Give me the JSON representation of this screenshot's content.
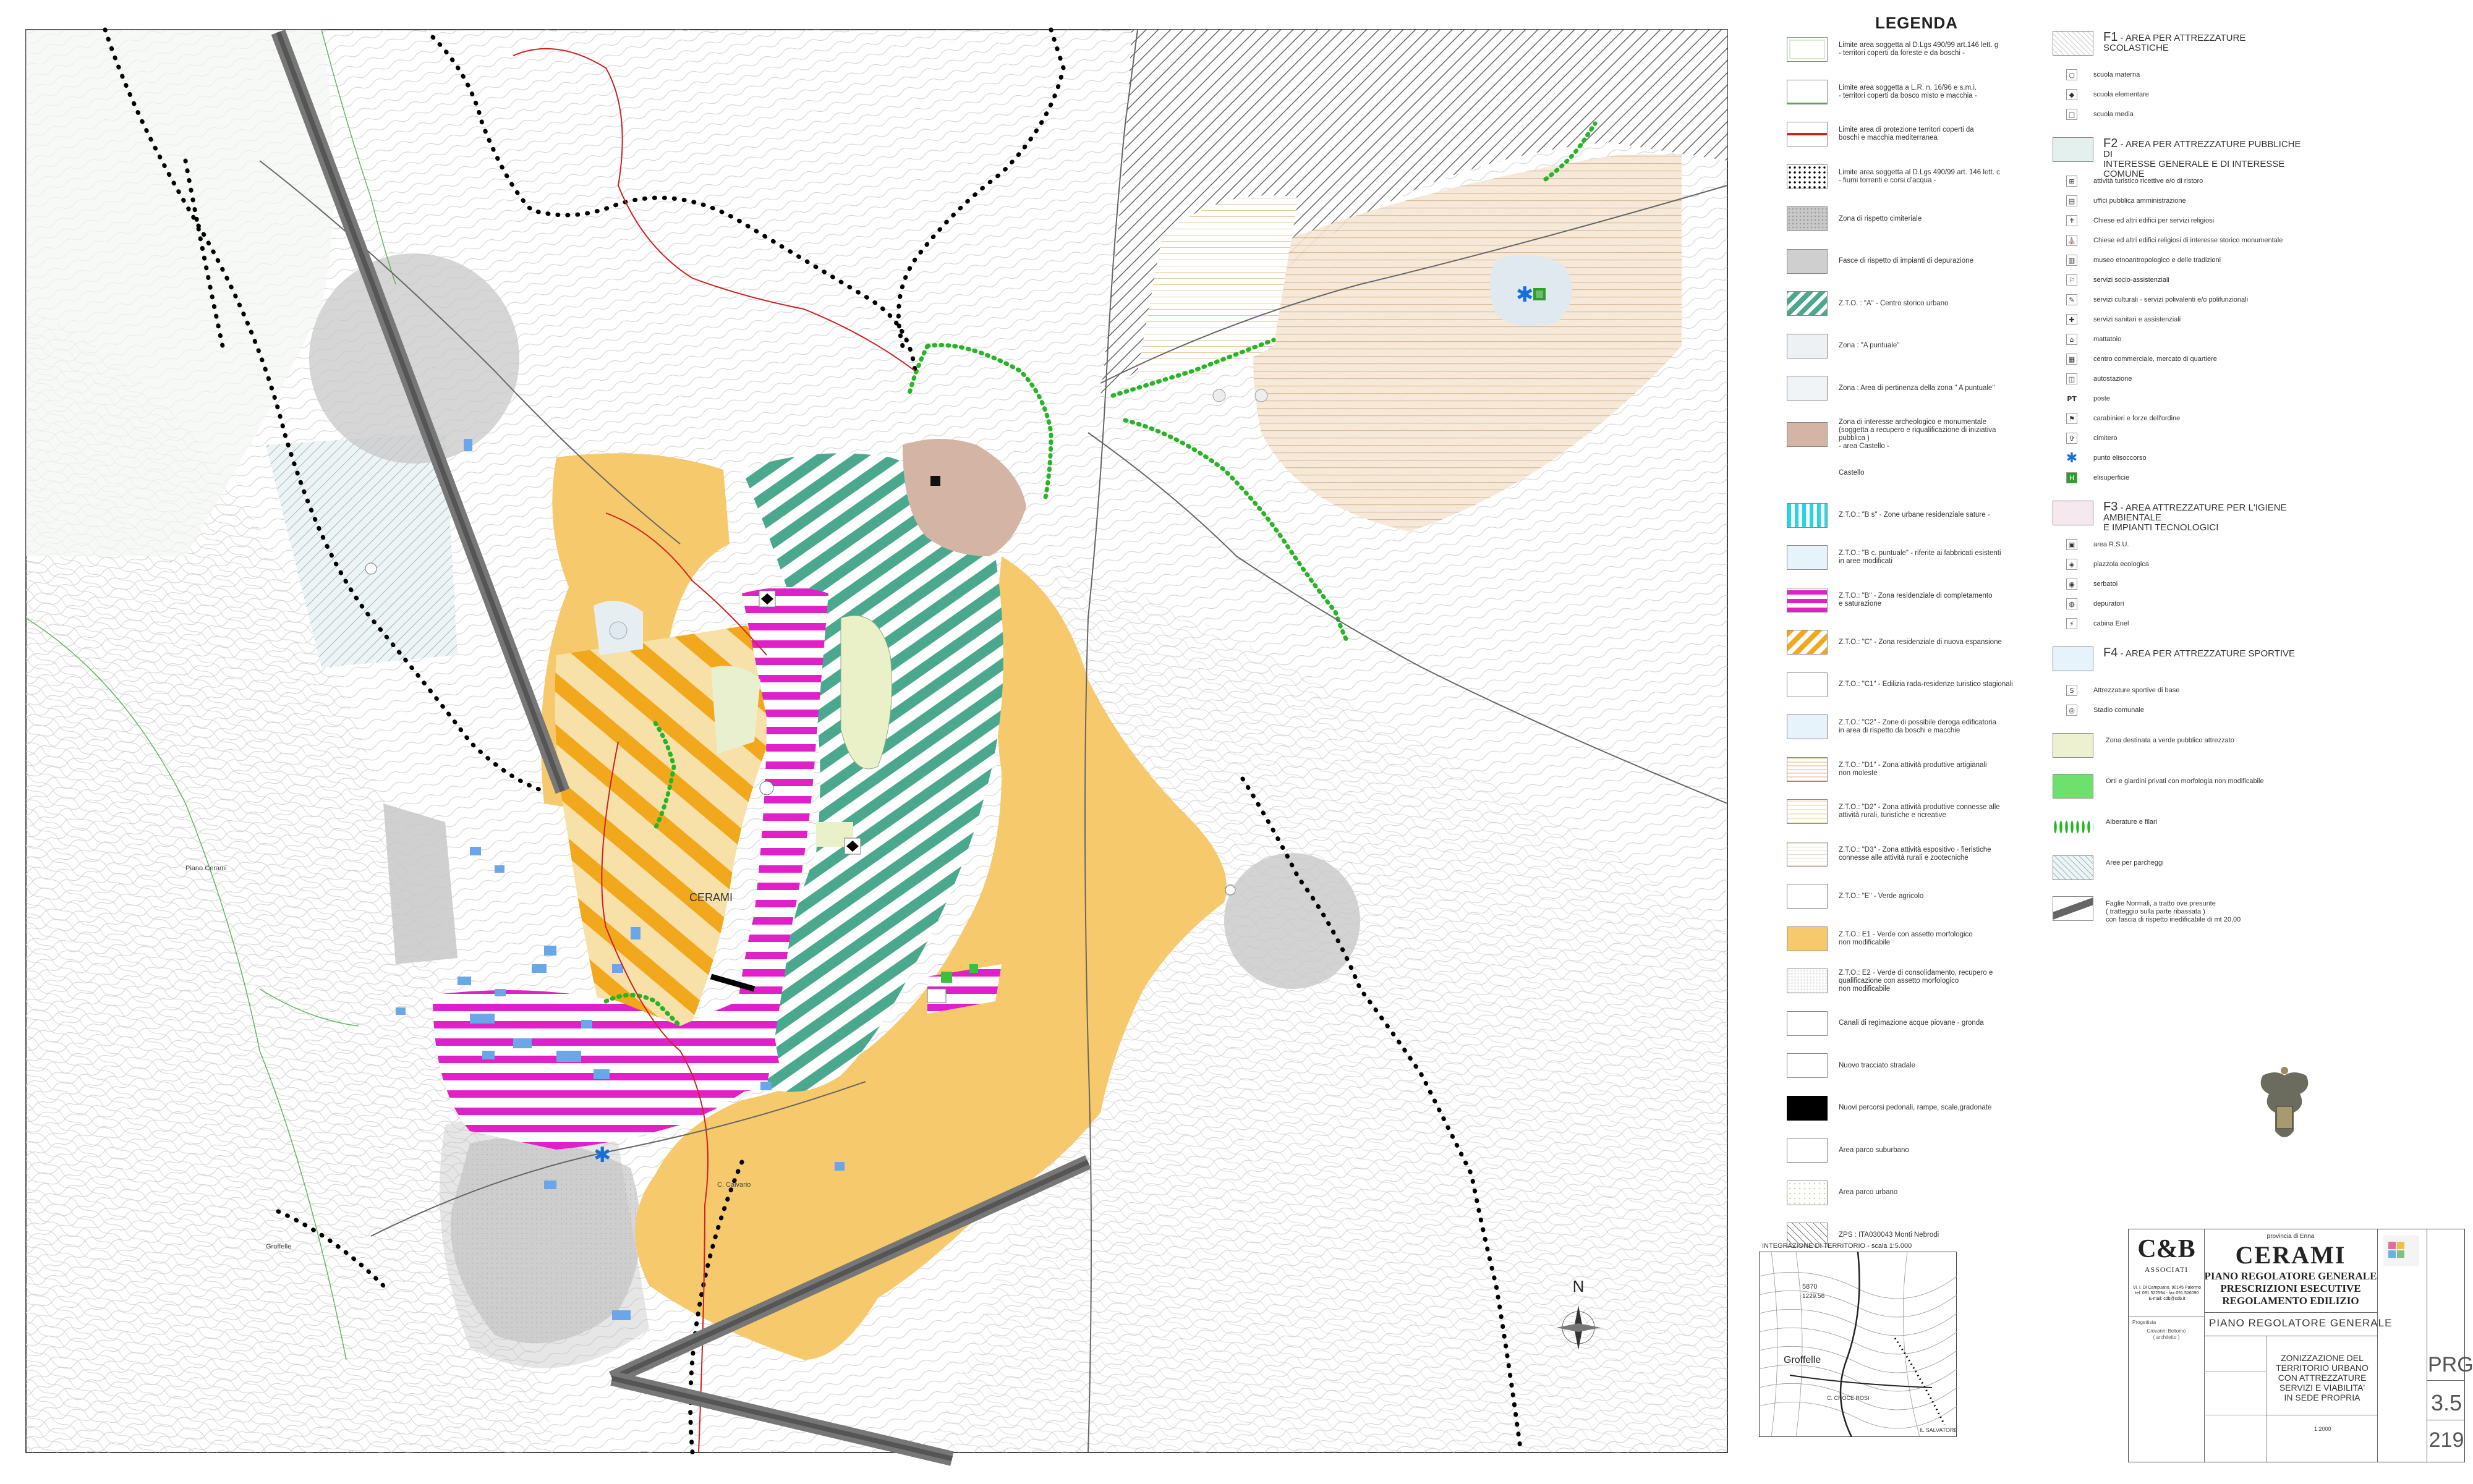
{
  "map": {
    "town_label": "CERAMI",
    "place_labels": [
      "Piano Cerami",
      "Groffelle",
      "C. Calvario"
    ],
    "north_label": "N"
  },
  "legend": {
    "title": "LEGENDA",
    "items": [
      {
        "label": "Limite area soggetta al D.Lgs 490/99 art.146 lett. g\n- territori coperti da foreste e da boschi -"
      },
      {
        "label": "Limite area soggetta a L.R. n. 16/96 e s.m.i.\n- territori coperti da bosco misto e macchia -"
      },
      {
        "label": "Limite area di protezione territori coperti da\nboschi e macchia mediterranea"
      },
      {
        "label": "Limite area soggetta al D.Lgs 490/99 art. 146 lett. c\n- fiumi torrenti e corsi d'acqua -"
      },
      {
        "label": "Zona di rispetto cimiteriale"
      },
      {
        "label": "Fasce di rispetto di impianti di depurazione"
      },
      {
        "label": "Z.T.O. : \"A\" - Centro storico urbano"
      },
      {
        "label": "Zona : \"A puntuale\""
      },
      {
        "label": "Zona : Area di pertinenza della zona \" A puntuale\""
      },
      {
        "label": "Zona di interesse archeologico e monumentale\n(soggetta a recupero e riqualificazione di iniziativa pubblica )\n- area Castello -"
      },
      {
        "label": "Castello"
      },
      {
        "label": "Z.T.O.: \"B s\" - Zone urbane residenziale sature -"
      },
      {
        "label": "Z.T.O.: \"B c. puntuale\" - riferite ai fabbricati esistenti\nin aree modificati"
      },
      {
        "label": "Z.T.O.: \"B\" - Zona residenziale di completamento\ne saturazione"
      },
      {
        "label": "Z.T.O.: \"C\" - Zona residenziale di nuova espansione"
      },
      {
        "label": "Z.T.O.: \"C1\" - Edilizia rada-residenze turistico stagionali"
      },
      {
        "label": "Z.T.O.: \"C2\" - Zone di possibile deroga edificatoria\nin area di rispetto da boschi e macchie"
      },
      {
        "label": "Z.T.O.: \"D1\" - Zona attività produttive artigianali\nnon moleste"
      },
      {
        "label": "Z.T.O.: \"D2\" - Zona attività produttive connesse alle\nattività rurali, turistiche e ricreative"
      },
      {
        "label": "Z.T.O.: \"D3\" - Zona attività espositivo - fieristiche\nconnesse alle attività rurali e zootecniche"
      },
      {
        "label": "Z.T.O.: \"E\" - Verde agricolo"
      },
      {
        "label": "Z.T.O.: E1 - Verde con assetto morfologico\nnon modificabile"
      },
      {
        "label": "Z.T.O.: E2 - Verde di consolidamento, recupero e\nqualificazione con assetto morfologico\nnon modificabile"
      },
      {
        "label": "Canali di regimazione acque piovane - gronda"
      },
      {
        "label": "Nuovo tracciato stradale"
      },
      {
        "label": "Nuovi percorsi pedonali, rampe, scale,gradonate"
      },
      {
        "label": "Area parco suburbano"
      },
      {
        "label": "Area parco urbano"
      },
      {
        "label": "ZPS : ITA030043 Monti Nebrodi"
      }
    ]
  },
  "services": {
    "f1": {
      "code": "F1",
      "title": " - AREA PER ATTREZZATURE SCOLASTICHE",
      "items": [
        {
          "label": "scuola materna",
          "icon": "circle"
        },
        {
          "label": "scuola elementare",
          "icon": "diamond"
        },
        {
          "label": "scuola media",
          "icon": "square"
        }
      ]
    },
    "f2": {
      "code": "F2",
      "title": " - AREA PER ATTREZZATURE PUBBLICHE DI\nINTERESSE GENERALE E DI INTERESSE COMUNE",
      "items": [
        {
          "label": "attività turistico ricettive e/o di ristoro",
          "icon": "bed"
        },
        {
          "label": "uffici pubblica amministrazione",
          "icon": "office"
        },
        {
          "label": "Chiese ed altri edifici per servizi religiosi",
          "icon": "cross"
        },
        {
          "label": "Chiese ed altri edifici religiosi di interesse storico monumentale",
          "icon": "church"
        },
        {
          "label": "museo etnoantropologico e delle tradizioni",
          "icon": "museum"
        },
        {
          "label": "servizi socio-assistenziali",
          "icon": "social"
        },
        {
          "label": "servizi culturali - servizi polivalenti e/o polifunzionali",
          "icon": "culture"
        },
        {
          "label": "servizi sanitari e assistenziali",
          "icon": "health"
        },
        {
          "label": "mattatoio",
          "icon": "slaughter"
        },
        {
          "label": "centro commerciale, mercato di quartiere",
          "icon": "market"
        },
        {
          "label": "autostazione",
          "icon": "bus"
        },
        {
          "label": "poste",
          "icon": "post",
          "text": "PT"
        },
        {
          "label": "carabinieri e forze dell'ordine",
          "icon": "police"
        },
        {
          "label": "cimitero",
          "icon": "cemetery"
        },
        {
          "label": "punto elisoccorso",
          "icon": "star"
        },
        {
          "label": "elisuperficie",
          "icon": "heli"
        }
      ]
    },
    "f3": {
      "code": "F3",
      "title": " - AREA ATTREZZATURE PER L'IGIENE AMBIENTALE\nE IMPIANTI TECNOLOGICI",
      "items": [
        {
          "label": "area R.S.U.",
          "icon": "rsu"
        },
        {
          "label": "piazzola ecologica",
          "icon": "eco"
        },
        {
          "label": "serbatoi",
          "icon": "tank"
        },
        {
          "label": "depuratori",
          "icon": "purifier"
        },
        {
          "label": "cabina Enel",
          "icon": "enel"
        }
      ]
    },
    "f4": {
      "code": "F4",
      "title": " - AREA PER ATTREZZATURE SPORTIVE",
      "items": [
        {
          "label": "Attrezzature sportive di base",
          "icon": "sport"
        },
        {
          "label": "Stadio comunale",
          "icon": "stadium"
        }
      ]
    },
    "other": [
      {
        "label": "Zona destinata a verde pubblico attrezzato"
      },
      {
        "label": "Orti e giardini privati con morfologia non modificabile"
      },
      {
        "label": "Alberature e filari"
      },
      {
        "label": "Aree per parcheggi"
      },
      {
        "label": "Faglie Normali, a tratto ove presunte\n( tratteggio sulla parte ribassata )\ncon fascia di rispetto inedificabile di mt 20,00"
      }
    ]
  },
  "inset": {
    "title": "INTEGRAZIONE DI TERRITORIO - scala 1:5.000",
    "labels": [
      "5870",
      "Groffelle",
      "C. CROCE ROSI",
      "IL SALVATORE",
      "1229.56"
    ]
  },
  "title_block": {
    "firm": "C&B",
    "firm_sub": "ASSOCIATI",
    "firm_address": "Vi. I. Di Campuano, 90145 Palermo\ntel. 091.522594 - fax 091.526090\nE-mail: cdb@cdb.it",
    "province": "provincia di Enna",
    "town": "CERAMI",
    "plan_lines": [
      "PIANO REGOLATORE GENERALE",
      "PRESCRIZIONI ESECUTIVE",
      "REGOLAMENTO EDILIZIO"
    ],
    "section": "PIANO REGOLATORE GENERALE",
    "drawing_title": "ZONIZZAZIONE DEL\nTERRITORIO URBANO\nCON ATTREZZATURE\nSERVIZI E VIABILITA'\nIN SEDE PROPRIA",
    "scale": "1:2000",
    "doc_type": "PRG",
    "table_no": "3.5",
    "sheet_no": "219",
    "designer_label": "Progettista",
    "designer": "Giovanni Bellomo\n( architetto )"
  }
}
